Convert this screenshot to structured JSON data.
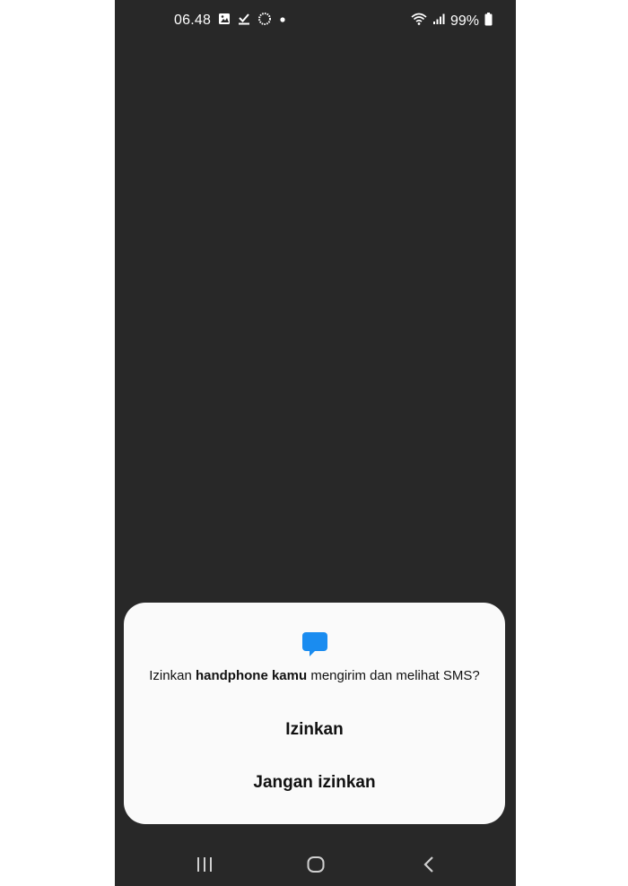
{
  "status_bar": {
    "time": "06.48",
    "battery": "99%",
    "icons_left": [
      "image-icon",
      "download-done-icon",
      "loading-icon",
      "dot-icon"
    ],
    "icons_right": [
      "wifi-icon",
      "signal-icon",
      "battery-icon"
    ]
  },
  "dialog": {
    "icon": "sms-icon",
    "icon_color": "#1a8cf0",
    "message_prefix": "Izinkan ",
    "app_name": "handphone kamu",
    "message_suffix": " mengirim dan melihat SMS?",
    "allow_label": "Izinkan",
    "deny_label": "Jangan izinkan"
  },
  "nav_bar": {
    "items": [
      "recents-button",
      "home-button",
      "back-button"
    ]
  }
}
